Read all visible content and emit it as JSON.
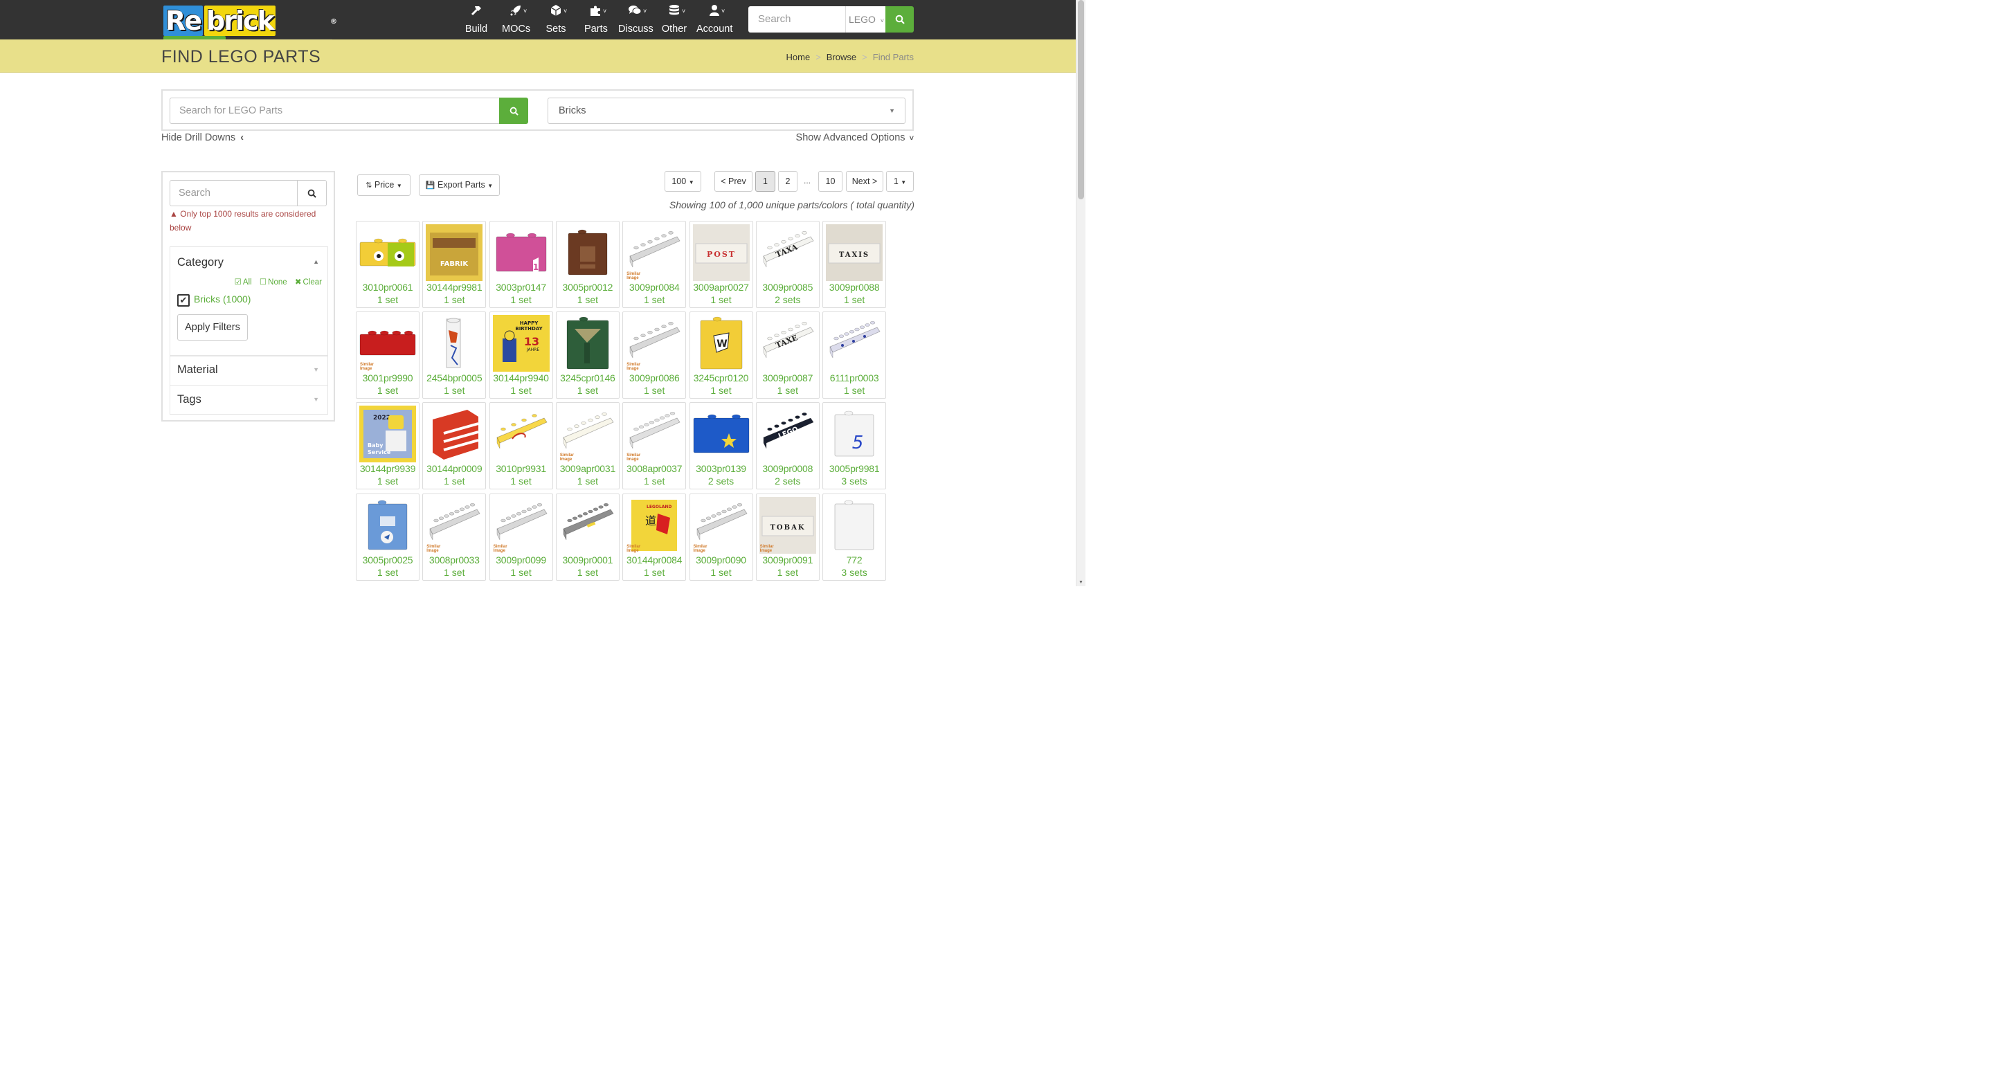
{
  "navbar": {
    "logo": "Rebrickable",
    "items": [
      {
        "label": "Build",
        "icon": "hammer-icon"
      },
      {
        "label": "MOCs",
        "icon": "rocket-icon"
      },
      {
        "label": "Sets",
        "icon": "cube-icon"
      },
      {
        "label": "Parts",
        "icon": "puzzle-icon"
      },
      {
        "label": "Discuss",
        "icon": "comments-icon"
      },
      {
        "label": "Other",
        "icon": "database-icon"
      },
      {
        "label": "Account",
        "icon": "user-icon"
      }
    ],
    "search_placeholder": "Search",
    "search_scope": "LEGO"
  },
  "header": {
    "title": "FIND LEGO PARTS",
    "breadcrumb": [
      "Home",
      "Browse",
      "Find Parts"
    ]
  },
  "search": {
    "placeholder": "Search for LEGO Parts",
    "category": "Bricks",
    "hide_drill": "Hide Drill Downs",
    "show_advanced": "Show Advanced Options"
  },
  "sidebar": {
    "search_placeholder": "Search",
    "warning": "Only top 1000 results are considered below",
    "category_title": "Category",
    "links": {
      "all": "All",
      "none": "None",
      "clear": "Clear"
    },
    "checked_item": "Bricks (1000)",
    "apply": "Apply Filters",
    "material": "Material",
    "tags": "Tags"
  },
  "toolbar": {
    "sort": "Price",
    "export": "Export Parts",
    "per_page": "100",
    "prev": "< Prev",
    "pages": [
      "1",
      "2",
      "10"
    ],
    "dots": "...",
    "next": "Next >",
    "jump": "1",
    "showing": "Showing 100 of 1,000 unique parts/colors ( total quantity)"
  },
  "colors": {
    "accent_green": "#5cae3b",
    "navbar": "#333333",
    "band": "#e8e08a"
  },
  "parts": [
    {
      "id": "3010pr0061",
      "count": "1 set"
    },
    {
      "id": "30144pr9981",
      "count": "1 set"
    },
    {
      "id": "3003pr0147",
      "count": "1 set"
    },
    {
      "id": "3005pr0012",
      "count": "1 set"
    },
    {
      "id": "3009pr0084",
      "count": "1 set"
    },
    {
      "id": "3009apr0027",
      "count": "1 set"
    },
    {
      "id": "3009pr0085",
      "count": "2 sets"
    },
    {
      "id": "3009pr0088",
      "count": "1 set"
    },
    {
      "id": "3001pr9990",
      "count": "1 set"
    },
    {
      "id": "2454bpr0005",
      "count": "1 set"
    },
    {
      "id": "30144pr9940",
      "count": "1 set"
    },
    {
      "id": "3245cpr0146",
      "count": "1 set"
    },
    {
      "id": "3009pr0086",
      "count": "1 set"
    },
    {
      "id": "3245cpr0120",
      "count": "1 set"
    },
    {
      "id": "3009pr0087",
      "count": "1 set"
    },
    {
      "id": "6111pr0003",
      "count": "1 set"
    },
    {
      "id": "30144pr9939",
      "count": "1 set"
    },
    {
      "id": "30144pr0009",
      "count": "1 set"
    },
    {
      "id": "3010pr9931",
      "count": "1 set"
    },
    {
      "id": "3009apr0031",
      "count": "1 set"
    },
    {
      "id": "3008apr0037",
      "count": "1 set"
    },
    {
      "id": "3003pr0139",
      "count": "2 sets"
    },
    {
      "id": "3009pr0008",
      "count": "2 sets"
    },
    {
      "id": "3005pr9981",
      "count": "3 sets"
    },
    {
      "id": "3005pr0025",
      "count": "1 set"
    },
    {
      "id": "3008pr0033",
      "count": "1 set"
    },
    {
      "id": "3009pr0099",
      "count": "1 set"
    },
    {
      "id": "3009pr0001",
      "count": "1 set"
    },
    {
      "id": "30144pr0084",
      "count": "1 set"
    },
    {
      "id": "3009pr0090",
      "count": "1 set"
    },
    {
      "id": "3009pr0091",
      "count": "1 set"
    },
    {
      "id": "772",
      "count": "3 sets"
    }
  ],
  "thumb_text": {
    "fabrik": "FABRIK",
    "post": "POST",
    "taxa": "TAXA",
    "taxis": "TAXIS",
    "taxe": "TAXE",
    "birthday_1": "HAPPY",
    "birthday_2": "BIRTHDAY",
    "birthday_3": "13",
    "birthday_4": "JAHRE",
    "year_2022": "2022",
    "baby": "Baby",
    "service": "Service",
    "lego": "LEGO",
    "tobak": "TOBAK",
    "num_1": "1",
    "num_5": "5",
    "legoland": "LEGOLAND",
    "similar_1": "Similar",
    "similar_2": "Image"
  }
}
